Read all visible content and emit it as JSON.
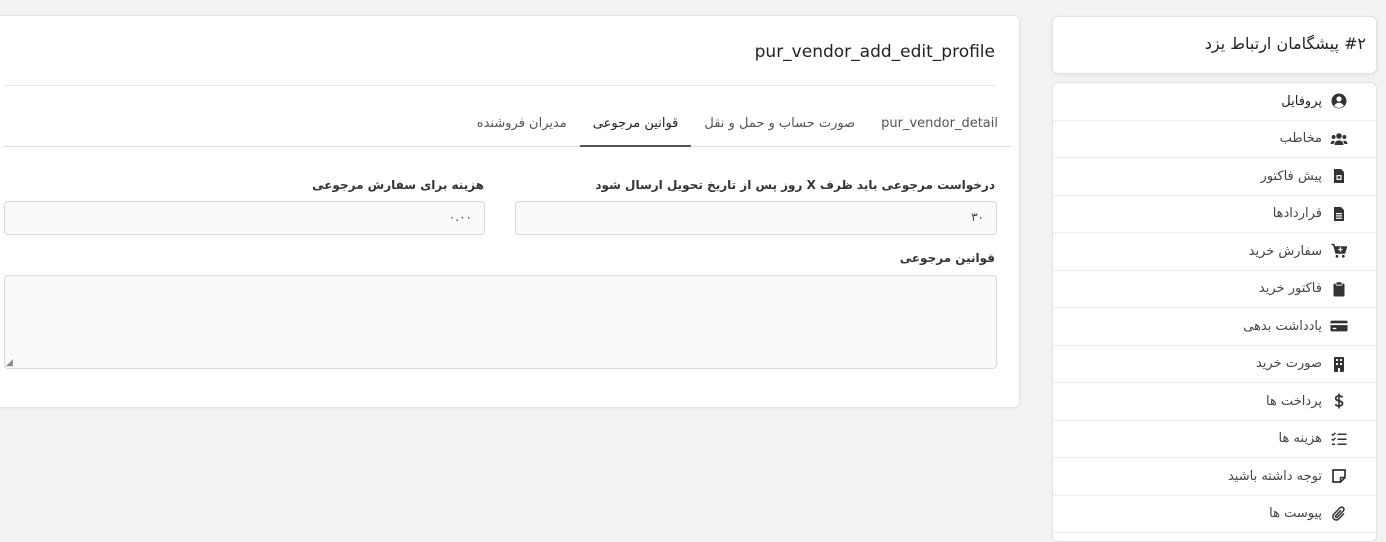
{
  "main": {
    "title": "pur_vendor_add_edit_profile",
    "tabs": [
      {
        "label": "pur_vendor_detail"
      },
      {
        "label": "صورت حساب و حمل و نقل"
      },
      {
        "label": "قوانین مرجوعی"
      },
      {
        "label": "مدیران فروشنده"
      }
    ],
    "active_tab": "قوانین مرجوعی",
    "return_days_label": "درخواست مرجوعی باید ظرف X روز پس از تاریخ تحویل ارسال شود",
    "return_days_value": "۳۰",
    "return_fee_label": "هزینه برای سفارش مرجوعی",
    "return_fee_value": "۰.۰۰",
    "return_policy_label": "قوانین مرجوعی",
    "return_policy_value": ""
  },
  "sidebar": {
    "title": "#۲ پیشگامان ارتباط یزد",
    "items": [
      {
        "label": "پروفایل",
        "icon": "user-circle-icon"
      },
      {
        "label": "مخاطب",
        "icon": "users-icon"
      },
      {
        "label": "پیش فاکتور",
        "icon": "file-invoice-icon"
      },
      {
        "label": "قراردادها",
        "icon": "file-text-icon"
      },
      {
        "label": "سفارش خرید",
        "icon": "cart-plus-icon"
      },
      {
        "label": "فاکتور خرید",
        "icon": "clipboard-icon"
      },
      {
        "label": "یادداشت بدهی",
        "icon": "credit-card-icon"
      },
      {
        "label": "صورت خرید",
        "icon": "building-icon"
      },
      {
        "label": "پرداخت ها",
        "icon": "dollar-icon"
      },
      {
        "label": "هزینه ها",
        "icon": "list-check-icon"
      },
      {
        "label": "توجه داشته باشید",
        "icon": "sticky-note-icon"
      },
      {
        "label": "پیوست ها",
        "icon": "paperclip-icon"
      }
    ]
  }
}
